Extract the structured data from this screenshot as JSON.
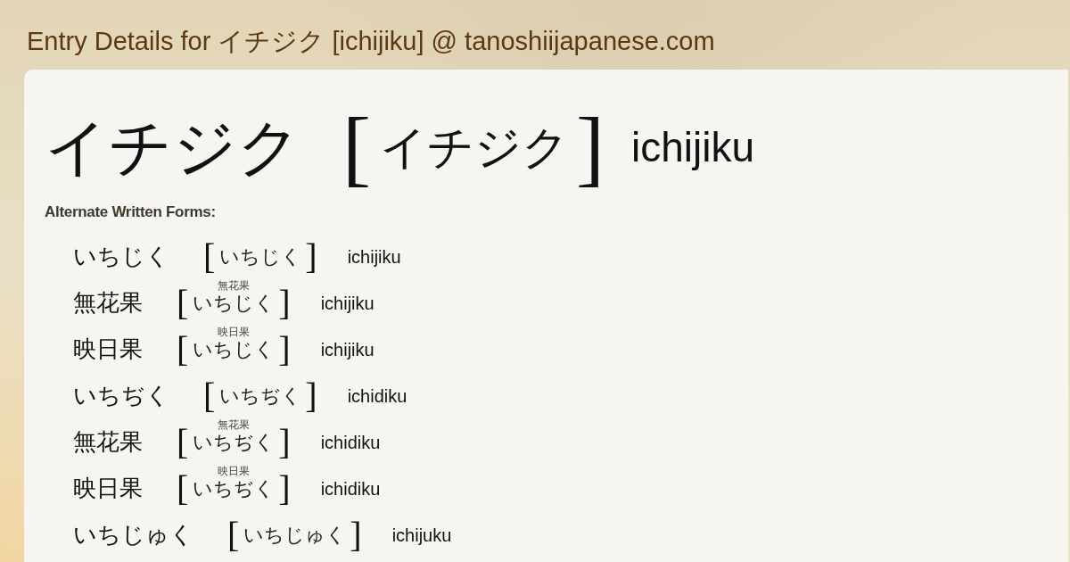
{
  "page_title": "Entry Details for イチジク [ichijiku] @ tanoshiijapanese.com",
  "entry": {
    "written": "イチジク",
    "reading": {
      "open": "[",
      "kana": "イチジク",
      "close": "]"
    },
    "romaji": "ichijiku"
  },
  "alternate_forms": {
    "heading": "Alternate Written Forms:",
    "items": [
      {
        "written": "いちじく",
        "reading": {
          "open": "[",
          "kana": "いちじく",
          "close": "]"
        },
        "romaji": "ichijiku"
      },
      {
        "written": "無花果",
        "ruby": "無花果",
        "reading": {
          "open": "[",
          "kana": "いちじく",
          "close": "]"
        },
        "romaji": "ichijiku"
      },
      {
        "written": "映日果",
        "ruby": "映日果",
        "reading": {
          "open": "[",
          "kana": "いちじく",
          "close": "]"
        },
        "romaji": "ichijiku"
      },
      {
        "written": "いちぢく",
        "reading": {
          "open": "[",
          "kana": "いちぢく",
          "close": "]"
        },
        "romaji": "ichidiku"
      },
      {
        "written": "無花果",
        "ruby": "無花果",
        "reading": {
          "open": "[",
          "kana": "いちぢく",
          "close": "]"
        },
        "romaji": "ichidiku"
      },
      {
        "written": "映日果",
        "ruby": "映日果",
        "reading": {
          "open": "[",
          "kana": "いちぢく",
          "close": "]"
        },
        "romaji": "ichidiku"
      },
      {
        "written": "いちじゅく",
        "reading": {
          "open": "[",
          "kana": "いちじゅく",
          "close": "]"
        },
        "romaji": "ichijuku"
      }
    ]
  }
}
